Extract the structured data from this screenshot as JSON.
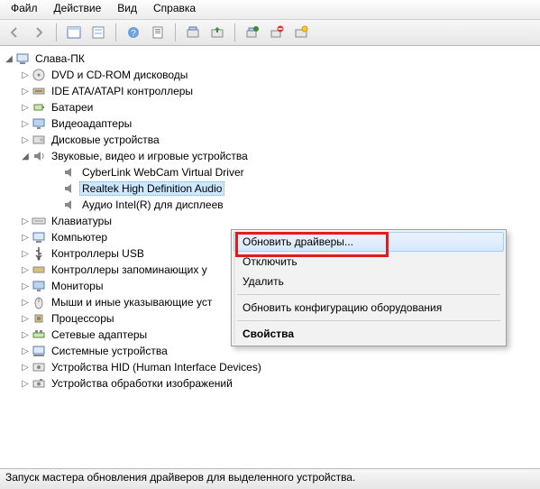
{
  "menu": {
    "file": "Файл",
    "action": "Действие",
    "view": "Вид",
    "help": "Справка"
  },
  "tree": {
    "root": "Слава-ПК",
    "items": [
      {
        "label": "DVD и CD-ROM дисководы",
        "icon": "disc"
      },
      {
        "label": "IDE ATA/ATAPI контроллеры",
        "icon": "ide"
      },
      {
        "label": "Батареи",
        "icon": "battery"
      },
      {
        "label": "Видеоадаптеры",
        "icon": "display"
      },
      {
        "label": "Дисковые устройства",
        "icon": "disk"
      },
      {
        "label": "Звуковые, видео и игровые устройства",
        "icon": "sound",
        "expanded": true,
        "children": [
          {
            "label": "CyberLink WebCam Virtual Driver",
            "icon": "speaker"
          },
          {
            "label": "Realtek High Definition Audio",
            "icon": "speaker",
            "selected": true
          },
          {
            "label": "Аудио Intel(R) для дисплеев",
            "icon": "speaker"
          }
        ]
      },
      {
        "label": "Клавиатуры",
        "icon": "keyboard"
      },
      {
        "label": "Компьютер",
        "icon": "computer"
      },
      {
        "label": "Контроллеры USB",
        "icon": "usb"
      },
      {
        "label": "Контроллеры запоминающих у",
        "icon": "storage",
        "truncated": true
      },
      {
        "label": "Мониторы",
        "icon": "monitor"
      },
      {
        "label": "Мыши и иные указывающие уст",
        "icon": "mouse",
        "truncated": true
      },
      {
        "label": "Процессоры",
        "icon": "cpu"
      },
      {
        "label": "Сетевые адаптеры",
        "icon": "network"
      },
      {
        "label": "Системные устройства",
        "icon": "system"
      },
      {
        "label": "Устройства HID (Human Interface Devices)",
        "icon": "hid"
      },
      {
        "label": "Устройства обработки изображений",
        "icon": "imaging"
      }
    ]
  },
  "context_menu": {
    "update": "Обновить драйверы...",
    "disable": "Отключить",
    "delete": "Удалить",
    "refresh": "Обновить конфигурацию оборудования",
    "properties": "Свойства"
  },
  "status": "Запуск мастера обновления драйверов для выделенного устройства."
}
